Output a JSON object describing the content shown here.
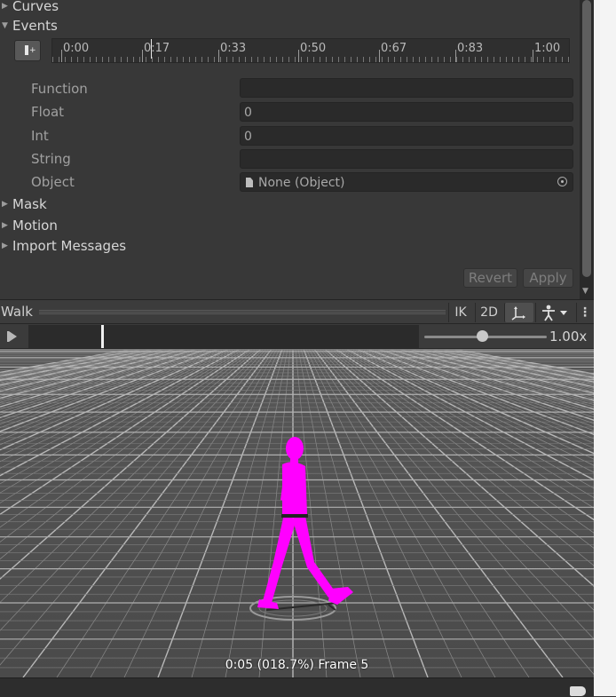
{
  "inspector": {
    "foldouts": {
      "curves": "Curves",
      "events": "Events",
      "mask": "Mask",
      "motion": "Motion",
      "import_messages": "Import Messages"
    },
    "ruler_ticks": [
      "0:00",
      "0:17",
      "0:33",
      "0:50",
      "0:67",
      "0:83",
      "1:00"
    ],
    "event_properties": {
      "function_label": "Function",
      "function_value": "",
      "float_label": "Float",
      "float_value": "0",
      "int_label": "Int",
      "int_value": "0",
      "string_label": "String",
      "string_value": "",
      "object_label": "Object",
      "object_value": "None (Object)"
    },
    "revert_label": "Revert",
    "apply_label": "Apply"
  },
  "preview": {
    "title": "Walk",
    "ik_label": "IK",
    "twod_label": "2D",
    "speed_label": "1.00x",
    "playback_fraction": 0.187,
    "frame_info": "0:05 (018.7%) Frame 5"
  },
  "colors": {
    "panel_bg": "#383838",
    "field_bg": "#2a2a2a",
    "character": "#ff00ff",
    "grid_floor": "#5a5a5a"
  },
  "icons": {
    "add_event": "add-event-icon",
    "move_tool": "move-axes-icon",
    "avatar": "avatar-icon",
    "object_picker": "object-picker-icon",
    "tag": "tag-icon"
  }
}
